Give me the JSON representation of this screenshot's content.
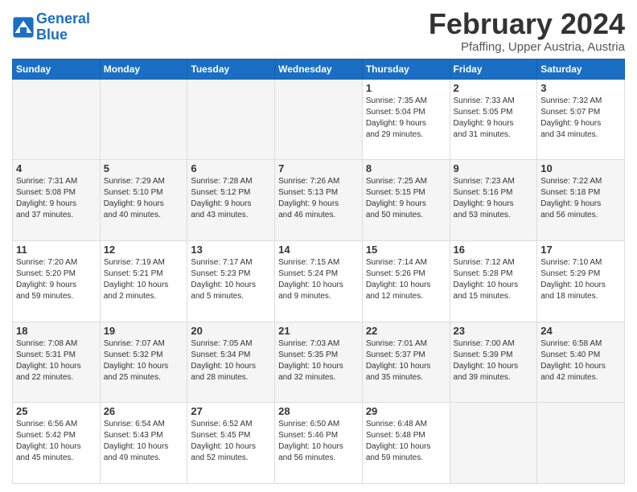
{
  "logo": {
    "text_general": "General",
    "text_blue": "Blue"
  },
  "header": {
    "title": "February 2024",
    "subtitle": "Pfaffing, Upper Austria, Austria"
  },
  "weekdays": [
    "Sunday",
    "Monday",
    "Tuesday",
    "Wednesday",
    "Thursday",
    "Friday",
    "Saturday"
  ],
  "weeks": [
    [
      {
        "day": "",
        "info": ""
      },
      {
        "day": "",
        "info": ""
      },
      {
        "day": "",
        "info": ""
      },
      {
        "day": "",
        "info": ""
      },
      {
        "day": "1",
        "info": "Sunrise: 7:35 AM\nSunset: 5:04 PM\nDaylight: 9 hours\nand 29 minutes."
      },
      {
        "day": "2",
        "info": "Sunrise: 7:33 AM\nSunset: 5:05 PM\nDaylight: 9 hours\nand 31 minutes."
      },
      {
        "day": "3",
        "info": "Sunrise: 7:32 AM\nSunset: 5:07 PM\nDaylight: 9 hours\nand 34 minutes."
      }
    ],
    [
      {
        "day": "4",
        "info": "Sunrise: 7:31 AM\nSunset: 5:08 PM\nDaylight: 9 hours\nand 37 minutes."
      },
      {
        "day": "5",
        "info": "Sunrise: 7:29 AM\nSunset: 5:10 PM\nDaylight: 9 hours\nand 40 minutes."
      },
      {
        "day": "6",
        "info": "Sunrise: 7:28 AM\nSunset: 5:12 PM\nDaylight: 9 hours\nand 43 minutes."
      },
      {
        "day": "7",
        "info": "Sunrise: 7:26 AM\nSunset: 5:13 PM\nDaylight: 9 hours\nand 46 minutes."
      },
      {
        "day": "8",
        "info": "Sunrise: 7:25 AM\nSunset: 5:15 PM\nDaylight: 9 hours\nand 50 minutes."
      },
      {
        "day": "9",
        "info": "Sunrise: 7:23 AM\nSunset: 5:16 PM\nDaylight: 9 hours\nand 53 minutes."
      },
      {
        "day": "10",
        "info": "Sunrise: 7:22 AM\nSunset: 5:18 PM\nDaylight: 9 hours\nand 56 minutes."
      }
    ],
    [
      {
        "day": "11",
        "info": "Sunrise: 7:20 AM\nSunset: 5:20 PM\nDaylight: 9 hours\nand 59 minutes."
      },
      {
        "day": "12",
        "info": "Sunrise: 7:19 AM\nSunset: 5:21 PM\nDaylight: 10 hours\nand 2 minutes."
      },
      {
        "day": "13",
        "info": "Sunrise: 7:17 AM\nSunset: 5:23 PM\nDaylight: 10 hours\nand 5 minutes."
      },
      {
        "day": "14",
        "info": "Sunrise: 7:15 AM\nSunset: 5:24 PM\nDaylight: 10 hours\nand 9 minutes."
      },
      {
        "day": "15",
        "info": "Sunrise: 7:14 AM\nSunset: 5:26 PM\nDaylight: 10 hours\nand 12 minutes."
      },
      {
        "day": "16",
        "info": "Sunrise: 7:12 AM\nSunset: 5:28 PM\nDaylight: 10 hours\nand 15 minutes."
      },
      {
        "day": "17",
        "info": "Sunrise: 7:10 AM\nSunset: 5:29 PM\nDaylight: 10 hours\nand 18 minutes."
      }
    ],
    [
      {
        "day": "18",
        "info": "Sunrise: 7:08 AM\nSunset: 5:31 PM\nDaylight: 10 hours\nand 22 minutes."
      },
      {
        "day": "19",
        "info": "Sunrise: 7:07 AM\nSunset: 5:32 PM\nDaylight: 10 hours\nand 25 minutes."
      },
      {
        "day": "20",
        "info": "Sunrise: 7:05 AM\nSunset: 5:34 PM\nDaylight: 10 hours\nand 28 minutes."
      },
      {
        "day": "21",
        "info": "Sunrise: 7:03 AM\nSunset: 5:35 PM\nDaylight: 10 hours\nand 32 minutes."
      },
      {
        "day": "22",
        "info": "Sunrise: 7:01 AM\nSunset: 5:37 PM\nDaylight: 10 hours\nand 35 minutes."
      },
      {
        "day": "23",
        "info": "Sunrise: 7:00 AM\nSunset: 5:39 PM\nDaylight: 10 hours\nand 39 minutes."
      },
      {
        "day": "24",
        "info": "Sunrise: 6:58 AM\nSunset: 5:40 PM\nDaylight: 10 hours\nand 42 minutes."
      }
    ],
    [
      {
        "day": "25",
        "info": "Sunrise: 6:56 AM\nSunset: 5:42 PM\nDaylight: 10 hours\nand 45 minutes."
      },
      {
        "day": "26",
        "info": "Sunrise: 6:54 AM\nSunset: 5:43 PM\nDaylight: 10 hours\nand 49 minutes."
      },
      {
        "day": "27",
        "info": "Sunrise: 6:52 AM\nSunset: 5:45 PM\nDaylight: 10 hours\nand 52 minutes."
      },
      {
        "day": "28",
        "info": "Sunrise: 6:50 AM\nSunset: 5:46 PM\nDaylight: 10 hours\nand 56 minutes."
      },
      {
        "day": "29",
        "info": "Sunrise: 6:48 AM\nSunset: 5:48 PM\nDaylight: 10 hours\nand 59 minutes."
      },
      {
        "day": "",
        "info": ""
      },
      {
        "day": "",
        "info": ""
      }
    ]
  ]
}
